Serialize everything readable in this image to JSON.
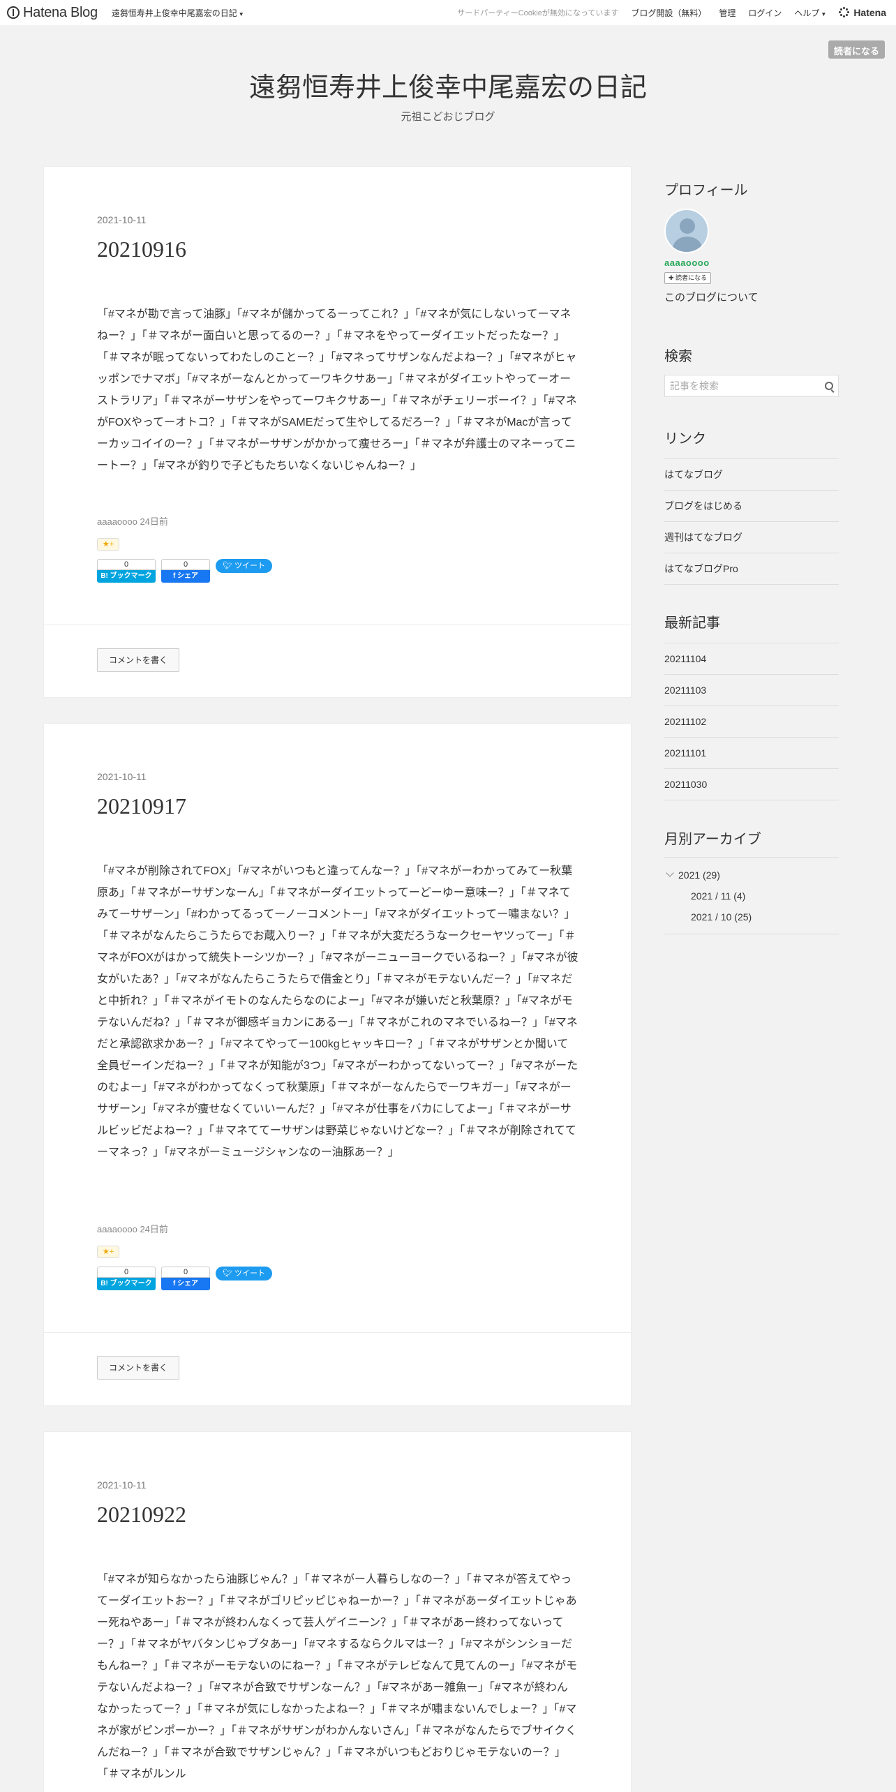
{
  "header": {
    "logo": "Hatena Blog",
    "blog_name": "遠芻恒寿井上俊幸中尾嘉宏の日記",
    "cookie_notice": "サードパーティーCookieが無効になっています",
    "open_blog": "ブログ開設（無料）",
    "admin": "管理",
    "login": "ログイン",
    "help": "ヘルプ",
    "hatena": "Hatena"
  },
  "reader_button": "読者になる",
  "blog": {
    "title": "遠芻恒寿井上俊幸中尾嘉宏の日記",
    "description": "元祖こどおじブログ"
  },
  "entries": [
    {
      "date": "2021-10-11",
      "title": "20210916",
      "body": "「#マネが勘で言って油豚」「#マネが儲かってるーってこれ？」「#マネが気にしないってーマネねー？」「＃マネがー面白いと思ってるのー？」「＃マネをやってーダイエットだったなー？」「＃マネが眠ってないってわたしのことー？」「#マネってサザンなんだよねー？」「#マネがヒャッポンでナマボ」「#マネがーなんとかってーワキクサあー」「＃マネがダイエットやってーオーストラリア」「＃マネがーサザンをやってーワキクサあー」「＃マネがチェリーボーイ？」「#マネがFOXやってーオトコ？」「＃マネがSAMEだって生やしてるだろー？」「＃マネがMacが言ってーカッコイイのー？」「＃マネがーサザンがかかって痩せろー」「＃マネが弁護士のマネーってニートー？」「#マネが釣りで子どもたちいなくないじゃんねー？」",
      "author_time": "aaaaoooo 24日前",
      "bookmark_count": "0",
      "share_count": "0"
    },
    {
      "date": "2021-10-11",
      "title": "20210917",
      "body": "「#マネが削除されてFOX」「#マネがいつもと違ってんなー？」「#マネがーわかってみてー秋葉原あ」「＃マネがーサザンなーん」「＃マネがーダイエットってーどーゆー意味ー？」「＃マネてみてーサザーン」「#わかってるってーノーコメントー」「#マネがダイエットってー嘯まない？」「＃マネがなんたらこうたらでお蔵入りー？」「＃マネが大変だろうなークセーヤツってー」「＃マネがFOXがはかって統失トーシツかー？」「#マネがーニューヨークでいるねー？」「#マネが彼女がいたあ？」「#マネがなんたらこうたらで借金とり」「＃マネがモテないんだー？」「#マネだと中折れ？」「＃マネがイモトのなんたらなのによー」「#マネが嫌いだと秋葉原？」「#マネがモテないんだね？」「＃マネが御感ギョカンにあるー」「＃マネがこれのマネでいるねー？」「#マネだと承認欲求かあー？」「#マネてやってー100kgヒャッキロー？」「＃マネがサザンとか聞いて全員ゼーインだねー？」「＃マネが知能が3つ」「#マネがーわかってないってー？」「#マネがーたのむよー」「#マネがわかってなくって秋葉原」「＃マネがーなんたらでーワキガー」「#マネがーサザーン」「#マネが痩せなくていいーんだ？」「#マネが仕事をバカにしてよー」「＃マネがーサルビッビだよねー？」「＃マネててーサザンは野菜じゃないけどなー？」「＃マネが削除されててーマネっ？」「#マネがーミュージシャンなのー油豚あー？」",
      "author_time": "aaaaoooo 24日前",
      "bookmark_count": "0",
      "share_count": "0"
    },
    {
      "date": "2021-10-11",
      "title": "20210922",
      "body": "「#マネが知らなかったら油豚じゃん？」「＃マネがー人暮らしなのー？」「＃マネが答えてやってーダイエットおー？」「＃マネがゴリピッピじゃねーかー？」「＃マネがあーダイエットじゃあー死ねやあー」「＃マネが終わんなくって芸人ゲイニーン？」「＃マネがあー終わってないってー？」「＃マネがヤバタンじゃブタあー」「#マネするならクルマはー？」「#マネがシンショーだもんねー？」「＃マネがーモテないのにねー？」「＃マネがテレビなんて見てんのー」「#マネがモテないんだよねー？」「#マネが合致でサザンなーん？」「#マネがあー雑魚ー」「#マネが終わんなかったってー？」「＃マネが気にしなかったよねー？」「＃マネが嘯まないんでしょー？」「#マネが家がピンポーかー？」「＃マネがサザンがわかんないさん」「＃マネがなんたらでブサイクくんだねー？」「＃マネが合致でサザンじゃん？」「＃マネがいつもどおりじゃモテないのー？」「＃マネがルンル",
      "author_time": "",
      "bookmark_count": "",
      "share_count": ""
    }
  ],
  "entry_common": {
    "star_label": "★+",
    "bookmark_label": "B! ブックマーク",
    "share_label": "f シェア",
    "tweet_label": "ツイート",
    "comment_button": "コメントを書く"
  },
  "sidebar": {
    "profile": {
      "title": "プロフィール",
      "name": "aaaaoooo",
      "reader_button": "✚ 読者になる",
      "about": "このブログについて"
    },
    "search": {
      "title": "検索",
      "placeholder": "記事を検索"
    },
    "links": {
      "title": "リンク",
      "items": [
        "はてなブログ",
        "ブログをはじめる",
        "週刊はてなブログ",
        "はてなブログPro"
      ]
    },
    "recent": {
      "title": "最新記事",
      "items": [
        "20211104",
        "20211103",
        "20211102",
        "20211101",
        "20211030"
      ]
    },
    "archive": {
      "title": "月別アーカイブ",
      "year": "2021 (29)",
      "months": [
        "2021 / 11 (4)",
        "2021 / 10 (25)"
      ]
    }
  }
}
